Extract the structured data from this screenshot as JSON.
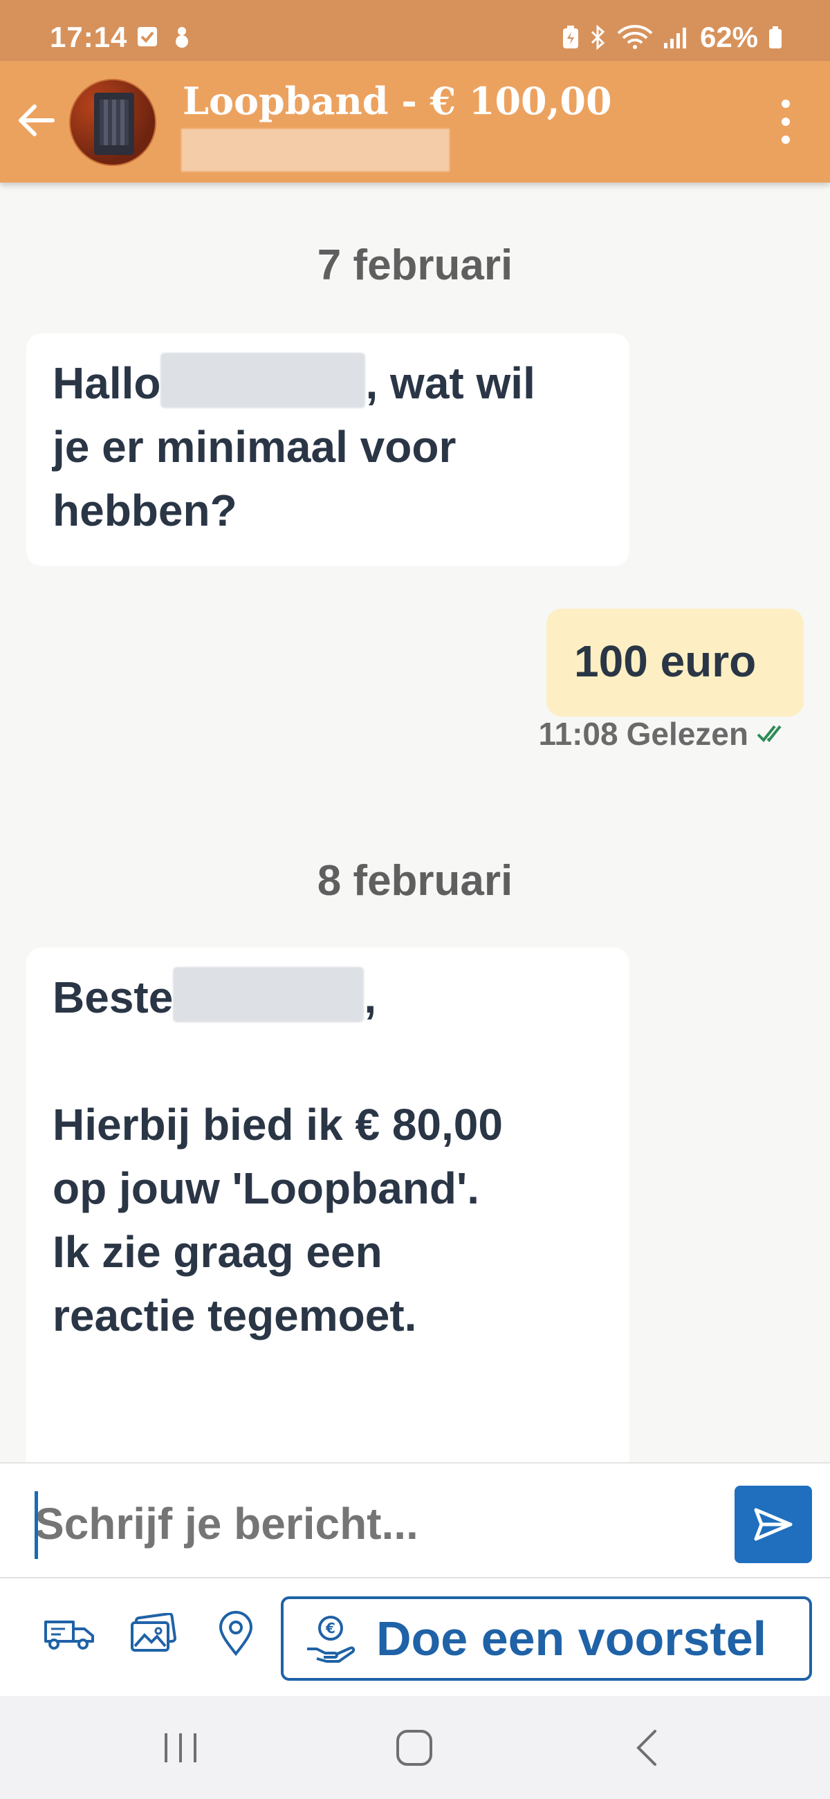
{
  "status_bar": {
    "time": "17:14",
    "battery": "62%"
  },
  "header": {
    "title": "Loopband - € 100,00",
    "avatar": "treadmill-product-thumbnail"
  },
  "messages": [
    {
      "type": "date",
      "label": "7 februari"
    },
    {
      "type": "incoming",
      "parts": [
        "Hallo",
        ", wat wil\nje er minimaal voor\nhebben?"
      ]
    },
    {
      "type": "outgoing",
      "text": "100 euro",
      "time": "11:08",
      "status": "Gelezen"
    },
    {
      "type": "date",
      "label": "8 februari"
    },
    {
      "type": "incoming",
      "parts": [
        "Beste",
        ",\n\nHierbij bied ik € 80,00\nop jouw 'Loopband'.\nIk zie graag een\nreactie tegemoet."
      ]
    }
  ],
  "composer": {
    "placeholder": "Schrijf je bericht..."
  },
  "actions": {
    "icons": [
      "truck-icon",
      "images-icon",
      "location-pin-icon"
    ],
    "proposal_label": "Doe een voorstel"
  },
  "colors": {
    "header": "#eca25f",
    "status_bar": "#d7925c",
    "primary_blue": "#1f6fbe",
    "outgoing_bubble": "#fdefc3",
    "read_check": "#2e8b57"
  }
}
